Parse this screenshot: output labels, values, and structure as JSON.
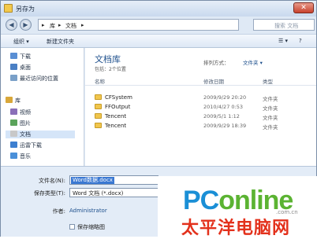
{
  "window": {
    "title": "另存为",
    "close_glyph": "✕"
  },
  "address": {
    "back_glyph": "◀",
    "forward_glyph": "▶",
    "crumbs": [
      "▸",
      "库",
      "▸",
      "文档",
      "▸"
    ],
    "search_placeholder": "搜索 文档"
  },
  "toolbar": {
    "organize": "组织 ▾",
    "new_folder": "新建文件夹",
    "view_glyph": "☰ ▾",
    "help_glyph": "?"
  },
  "sidebar": {
    "items": [
      {
        "label": "下载",
        "icon": "download-icon",
        "color": "#5a8fd4"
      },
      {
        "label": "桌面",
        "icon": "desktop-icon",
        "color": "#4a7fc4"
      },
      {
        "label": "最近访问的位置",
        "icon": "recent-places-icon",
        "color": "#7aa0c8"
      },
      {
        "label": "库",
        "icon": "library-icon",
        "color": "#d9a73a"
      },
      {
        "label": "视频",
        "icon": "video-icon",
        "color": "#8a6fb8"
      },
      {
        "label": "图片",
        "icon": "picture-icon",
        "color": "#5aa35a"
      },
      {
        "label": "文档",
        "icon": "document-icon",
        "color": "#c8c8c8"
      },
      {
        "label": "迅雷下载",
        "icon": "thunder-download-icon",
        "color": "#3d7fd0"
      },
      {
        "label": "音乐",
        "icon": "music-icon",
        "color": "#4a90d9"
      }
    ]
  },
  "main": {
    "library_title": "文档库",
    "library_subtitle": "包括：2个位置",
    "arrange_label": "排列方式：",
    "arrange_value": "文件夹 ▾",
    "columns": [
      "名称",
      "修改日期",
      "类型"
    ],
    "rows": [
      {
        "name": "CFSystem",
        "date": "2009/9/29 20:20",
        "type": "文件夹"
      },
      {
        "name": "FFOutput",
        "date": "2010/4/27 0:53",
        "type": "文件夹"
      },
      {
        "name": "Tencent",
        "date": "2009/5/1 1:12",
        "type": "文件夹"
      },
      {
        "name": "Tencent",
        "date": "2009/9/29 18:39",
        "type": "文件夹"
      }
    ]
  },
  "form": {
    "filename_label": "文件名(N):",
    "filename_value": "Word数据.docx",
    "filetype_label": "保存类型(T):",
    "filetype_value": "Word 文档 (*.docx)",
    "author_label": "作者:",
    "author_value": "Administrator",
    "thumbnail_label": "保存缩略图"
  },
  "watermark": {
    "brand_pc": "PC",
    "brand_online": "online",
    "domain": ".com.cn",
    "chinese": "太平洋电脑网"
  }
}
